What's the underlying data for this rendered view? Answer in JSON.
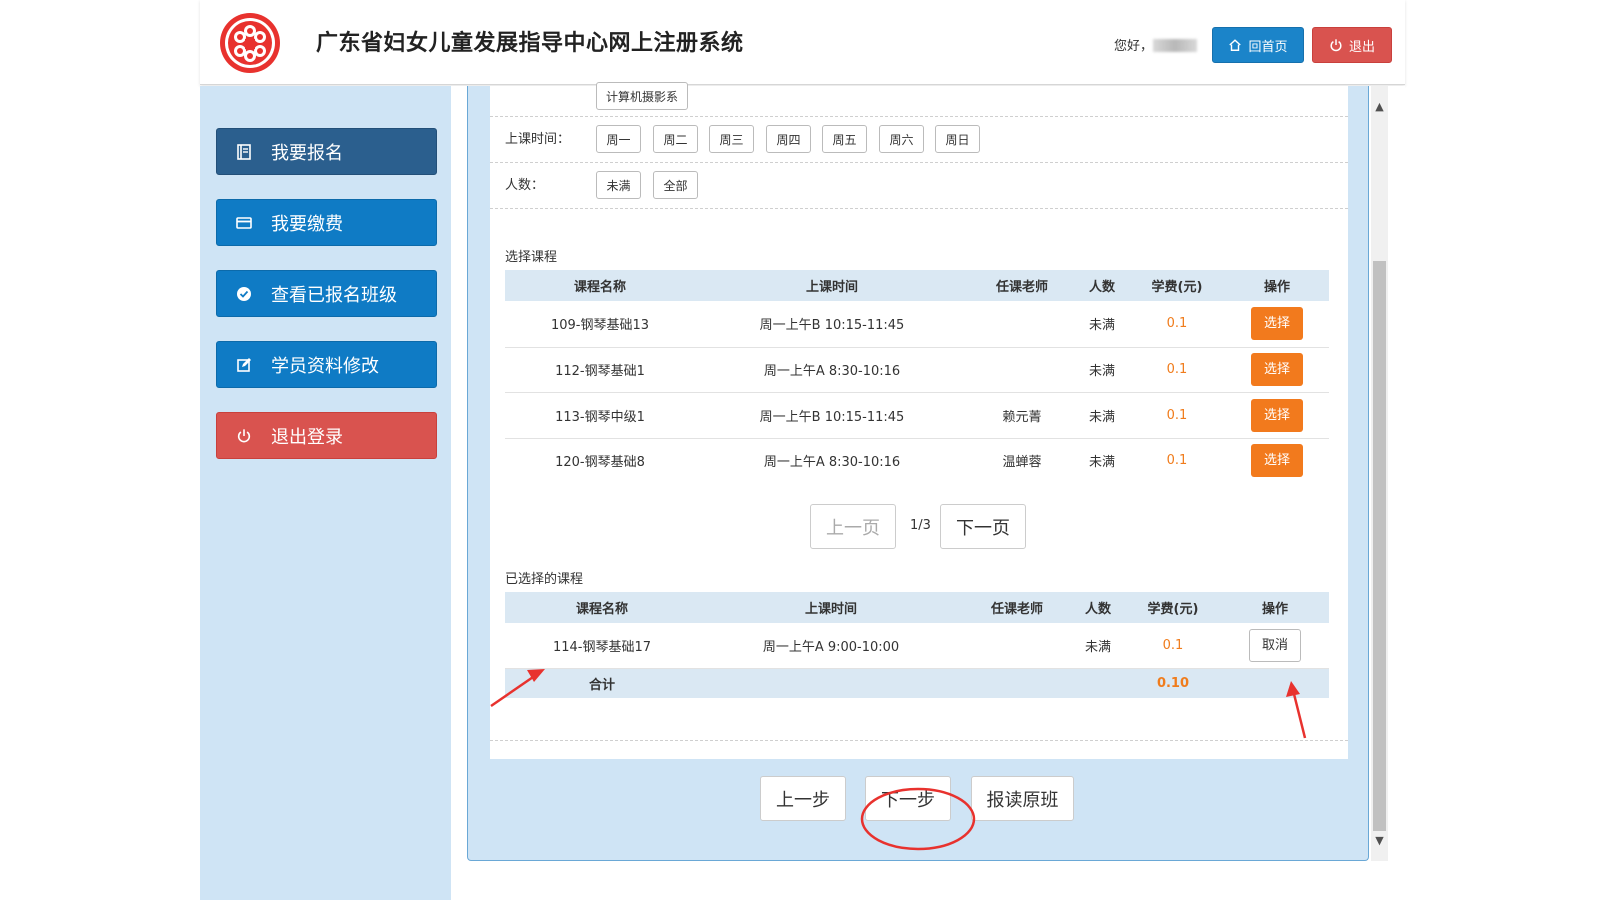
{
  "header": {
    "title": "广东省妇女儿童发展指导中心网上注册系统",
    "greeting": "您好，",
    "home_label": "回首页",
    "logout_label": "退出"
  },
  "sidebar": {
    "items": [
      {
        "label": "我要报名",
        "icon": "book-icon"
      },
      {
        "label": "我要缴费",
        "icon": "card-icon"
      },
      {
        "label": "查看已报名班级",
        "icon": "check-circle-icon"
      },
      {
        "label": "学员资料修改",
        "icon": "edit-icon"
      },
      {
        "label": "退出登录",
        "icon": "power-icon"
      }
    ]
  },
  "filters": {
    "category_option": "计算机摄影系",
    "time_label": "上课时间：",
    "days": [
      "周一",
      "周二",
      "周三",
      "周四",
      "周五",
      "周六",
      "周日"
    ],
    "count_label": "人数：",
    "count_options": [
      "未满",
      "全部"
    ]
  },
  "course_table": {
    "section_title": "选择课程",
    "headers": [
      "课程名称",
      "上课时间",
      "任课老师",
      "人数",
      "学费(元)",
      "操作"
    ],
    "rows": [
      {
        "name": "109-钢琴基础13",
        "time": "周一上午B 10:15-11:45",
        "teacher": "",
        "count": "未满",
        "fee": "0.1",
        "action": "选择"
      },
      {
        "name": "112-钢琴基础1",
        "time": "周一上午A 8:30-10:16",
        "teacher": "",
        "count": "未满",
        "fee": "0.1",
        "action": "选择"
      },
      {
        "name": "113-钢琴中级1",
        "time": "周一上午B 10:15-11:45",
        "teacher": "赖元菁",
        "count": "未满",
        "fee": "0.1",
        "action": "选择"
      },
      {
        "name": "120-钢琴基础8",
        "time": "周一上午A 8:30-10:16",
        "teacher": "温蝉蓉",
        "count": "未满",
        "fee": "0.1",
        "action": "选择"
      }
    ]
  },
  "pagination": {
    "prev_label": "上一页",
    "page_info": "1/3",
    "next_label": "下一页"
  },
  "selected_table": {
    "section_title": "已选择的课程",
    "headers": [
      "课程名称",
      "上课时间",
      "任课老师",
      "人数",
      "学费(元)",
      "操作"
    ],
    "rows": [
      {
        "name": "114-钢琴基础17",
        "time": "周一上午A 9:00-10:00",
        "teacher": "",
        "count": "未满",
        "fee": "0.1",
        "action": "取消"
      }
    ],
    "total_label": "合计",
    "total_value": "0.10"
  },
  "steps": {
    "prev_label": "上一步",
    "next_label": "下一步",
    "original_label": "报读原班"
  },
  "colors": {
    "primary": "#0f7bc5",
    "active_nav": "#2b5f8e",
    "danger": "#d9534f",
    "accent_orange": "#f27a1d",
    "annotation_red": "#e8322e"
  }
}
